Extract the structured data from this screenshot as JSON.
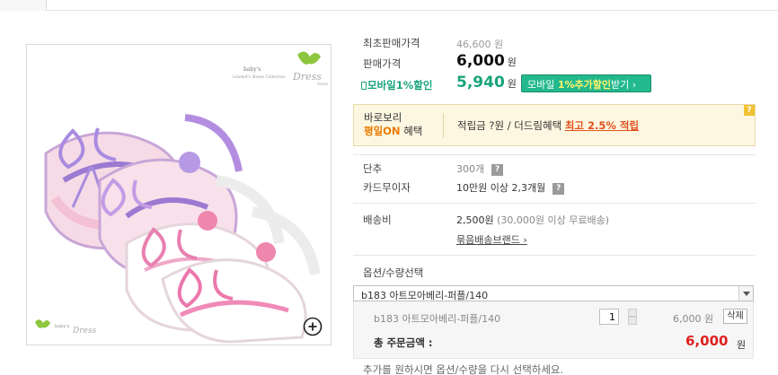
{
  "product": {
    "first_price_label": "최초판매가격",
    "first_price_value": "46,600 원",
    "price_label": "판매가격",
    "price_value": "6,000",
    "price_unit": "원",
    "mobile_label": "모바일1%할인",
    "mobile_price": "5,940",
    "mobile_unit": "원",
    "mobile_button_prefix": "모바일 ",
    "mobile_button_highlight": "1%추가할인",
    "mobile_button_suffix": "받기 ›"
  },
  "benefit": {
    "badge_line1": "바로보리",
    "badge_on": "평일ON",
    "badge_suffix": " 혜택",
    "text": "적립금 ?원 / 더드림혜택 ",
    "link": "최고 2.5% 적립",
    "help": "?"
  },
  "stock": {
    "label": "단추",
    "value": "300개",
    "help": "?"
  },
  "installment": {
    "label": "카드무이자",
    "value": "10만원 이상 2,3개월",
    "help": "?"
  },
  "shipping": {
    "label": "배송비",
    "value": "2,500원",
    "note": "(30,000원 이상 무료배송)",
    "brand_link": "묶음배송브랜드 ›"
  },
  "options": {
    "label": "옵션/수량선택",
    "selected": "b183 아트모아베리-퍼플/140",
    "item_name": "b183 아트모아베리-퍼플/140",
    "quantity": "1",
    "item_price": "6,000 원",
    "delete_label": "삭제",
    "total_label": "총 주문금액 :",
    "total_value": "6,000",
    "total_unit": "원"
  },
  "notice": "추가를 원하시면 옵션/수량을 다시 선택하세요.",
  "image": {
    "brand_top": "baby's\nLeaded's Shoes Collection Dress Shoes",
    "brand_logo": "Dress",
    "brand_bottom": "baby's Dress"
  },
  "colors": {
    "accent_green": "#22b98d",
    "price_red": "#e02020",
    "benefit_bg": "#fdf7e1",
    "benefit_link": "#e0501f"
  }
}
